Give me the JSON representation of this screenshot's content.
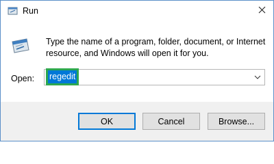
{
  "window": {
    "title": "Run",
    "close_glyph": "✕"
  },
  "content": {
    "description": "Type the name of a program, folder, document, or Internet resource, and Windows will open it for you.",
    "open_label": "Open:",
    "input_value": "regedit",
    "dropdown_glyph": "⌄"
  },
  "buttons": {
    "ok": "OK",
    "cancel": "Cancel",
    "browse": "Browse..."
  },
  "colors": {
    "selection": "#0078d7",
    "highlight_box": "#2ea84f",
    "footer_bg": "#f0f0f0"
  },
  "icons": {
    "app": "run-app-icon",
    "run": "run-icon",
    "close": "close-icon",
    "dropdown": "chevron-down-icon"
  }
}
